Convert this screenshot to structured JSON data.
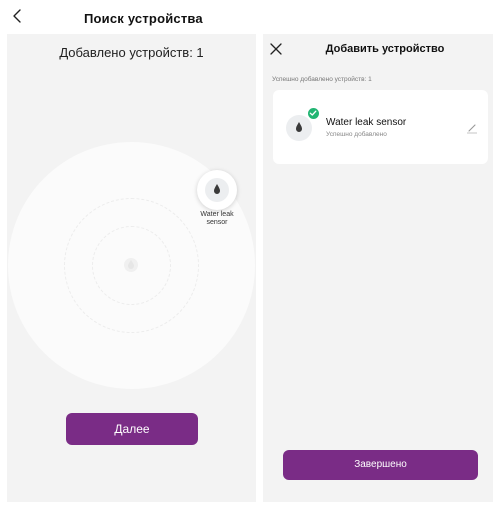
{
  "left_screen": {
    "title": "Поиск устройства",
    "added_count": "Добавлено устройств: 1",
    "found_device_label": "Water leak sensor",
    "next_button": "Далее"
  },
  "right_screen": {
    "title": "Добавить устройство",
    "success_count": "Успешно добавлено устройств: 1",
    "device": {
      "name": "Water leak sensor",
      "status": "Успешно добавлено"
    },
    "finish_button": "Завершено"
  },
  "colors": {
    "accent": "#7a2c86",
    "success": "#22b573",
    "panel_bg": "#f3f3f3"
  },
  "icons": [
    "back-icon",
    "close-icon",
    "water-drop-icon",
    "check-icon",
    "edit-pencil-icon"
  ]
}
